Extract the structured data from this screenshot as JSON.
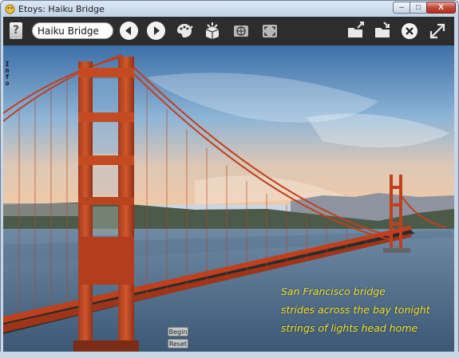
{
  "window": {
    "title": "Etoys: Haiku Bridge",
    "min_glyph": "–",
    "max_glyph": "□",
    "close_glyph": "X"
  },
  "toolbar": {
    "help_label": "?",
    "project_name": "Haiku Bridge"
  },
  "info_tab": "Info",
  "haiku": {
    "line1": "San Francisco bridge",
    "line2": "strides across the bay tonight",
    "line3": "strings of lights head home"
  },
  "buttons": {
    "begin": "Begin",
    "reset": "Reset"
  },
  "colors": {
    "toolbar": "#2d2d2d",
    "haiku_text": "#f5e431",
    "bridge": "#c0401e"
  }
}
